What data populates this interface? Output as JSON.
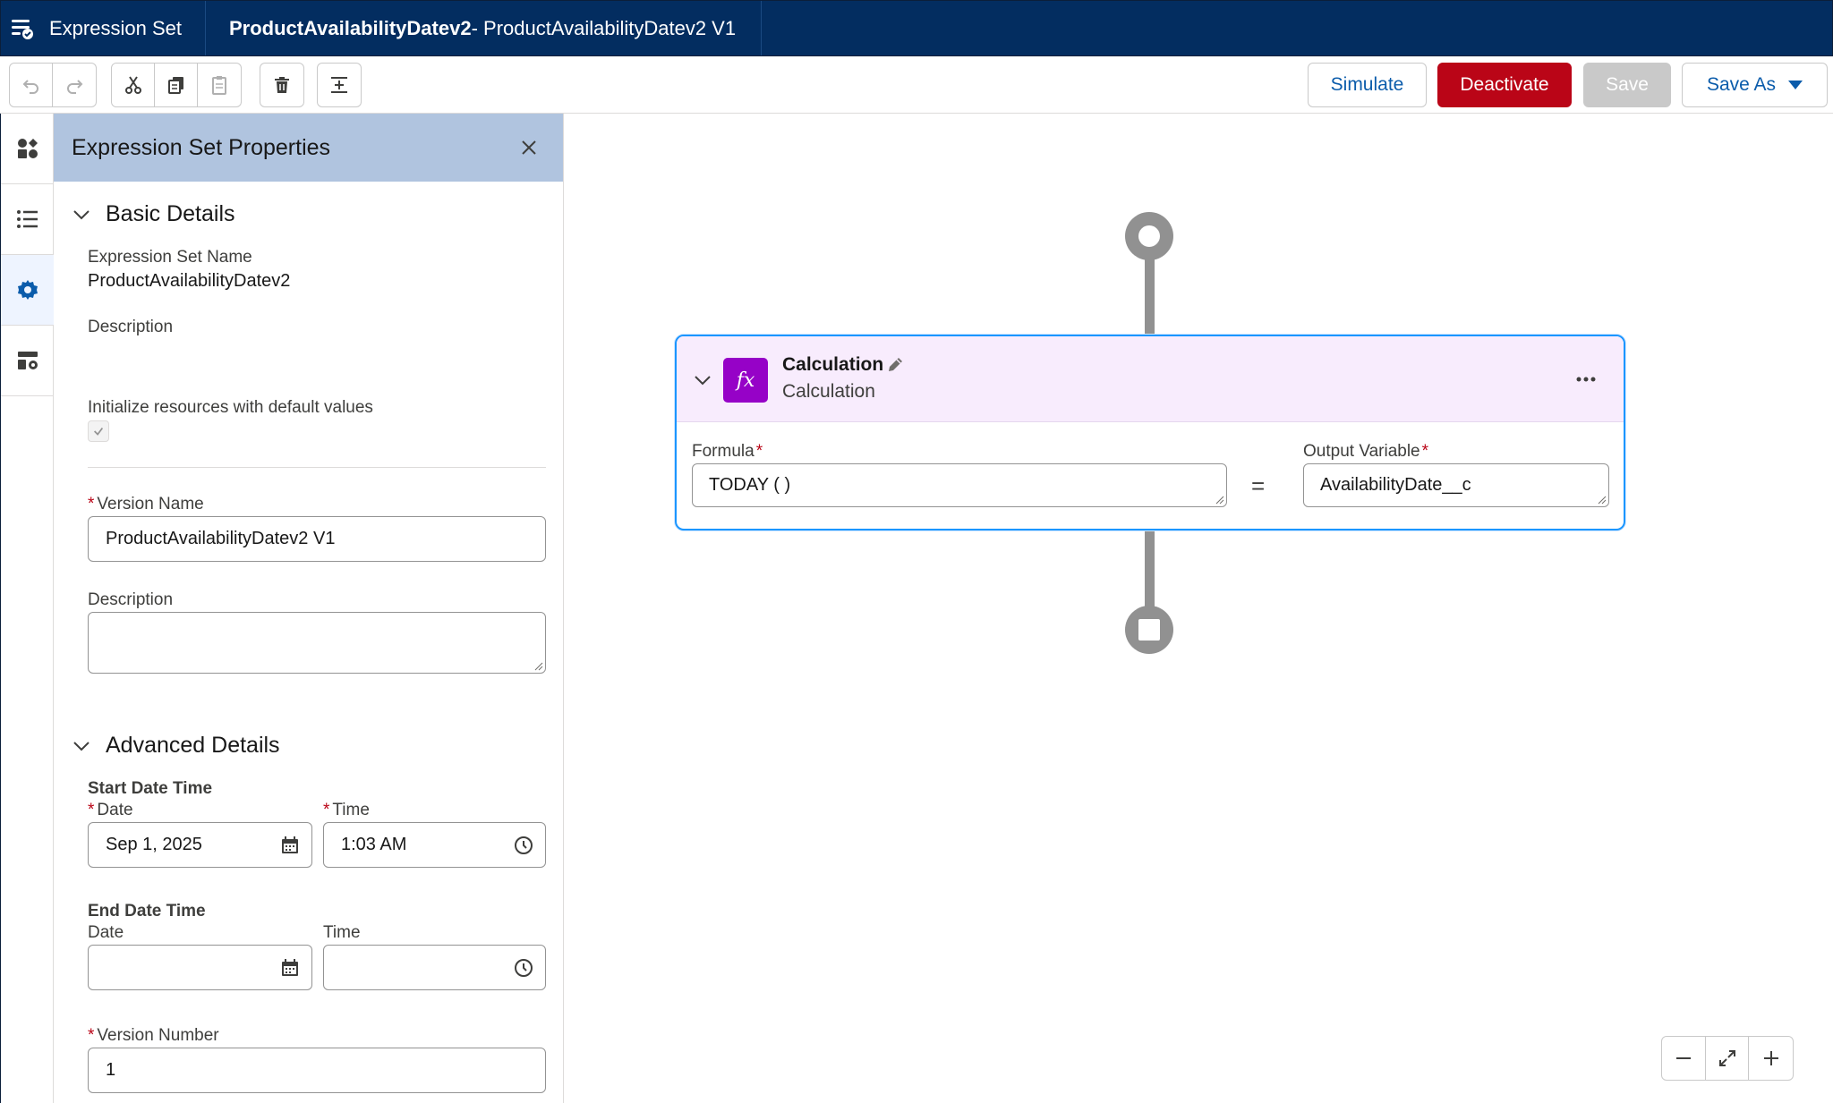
{
  "header": {
    "app_name": "Expression Set",
    "tab_title_bold": "ProductAvailabilityDatev2",
    "tab_title_rest": " - ProductAvailabilityDatev2 V1"
  },
  "toolbar": {
    "simulate_label": "Simulate",
    "deactivate_label": "Deactivate",
    "save_label": "Save",
    "save_as_label": "Save As"
  },
  "panel": {
    "title": "Expression Set Properties",
    "basic_details": {
      "heading": "Basic Details",
      "name_label": "Expression Set Name",
      "name_value": "ProductAvailabilityDatev2",
      "description_label": "Description",
      "init_label": "Initialize resources with default values",
      "init_checked": true,
      "version_name_label": "Version Name",
      "version_name_value": "ProductAvailabilityDatev2 V1",
      "version_description_label": "Description",
      "version_description_value": ""
    },
    "advanced_details": {
      "heading": "Advanced Details",
      "start_label": "Start Date Time",
      "start_date_label": "Date",
      "start_date_value": "Sep 1, 2025",
      "start_time_label": "Time",
      "start_time_value": "1:03 AM",
      "end_label": "End Date Time",
      "end_date_label": "Date",
      "end_date_value": "",
      "end_time_label": "Time",
      "end_time_value": "",
      "version_number_label": "Version Number",
      "version_number_value": "1"
    }
  },
  "canvas": {
    "card": {
      "title": "Calculation",
      "subtitle": "Calculation",
      "icon_text": "fx",
      "formula_label": "Formula",
      "formula_value": "TODAY ( )",
      "equals": "=",
      "output_label": "Output Variable",
      "output_value": "AvailabilityDate__c"
    }
  },
  "colors": {
    "header_bg": "#032d60",
    "panel_header_bg": "#b0c4df",
    "deactivate_bg": "#ba0517",
    "card_head_bg": "#f8ecfd",
    "calc_icon_bg": "#9602c7",
    "selection_border": "#1b96ff",
    "link_blue": "#0b5cab"
  }
}
